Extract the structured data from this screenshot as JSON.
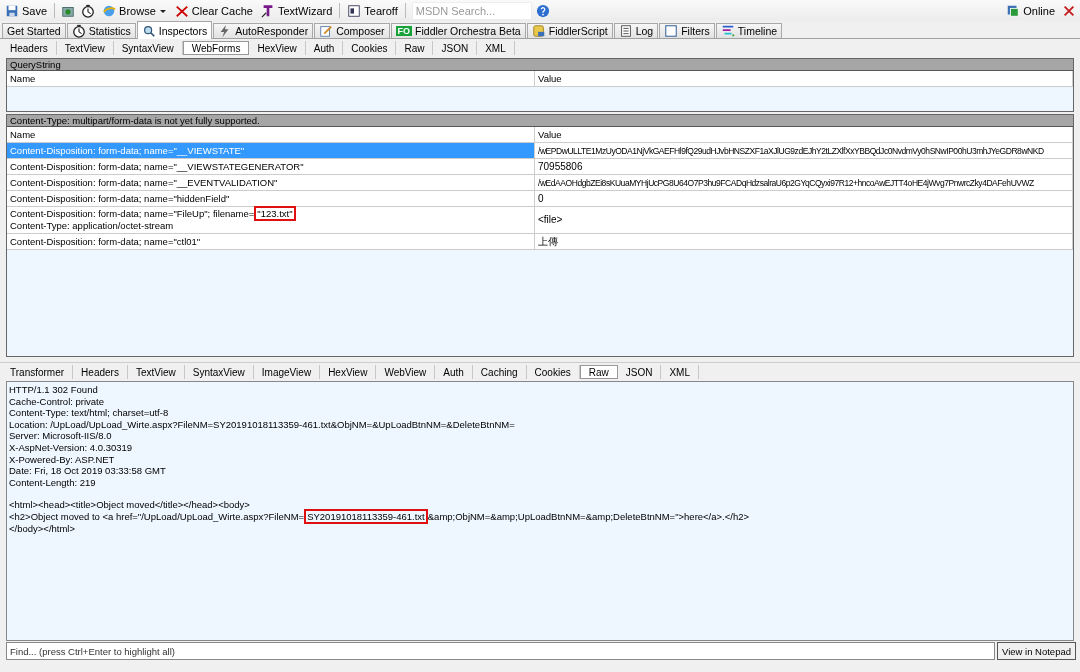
{
  "toolbar": {
    "items": [
      {
        "kind": "button",
        "label": "Save"
      },
      {
        "kind": "icon"
      },
      {
        "kind": "icon"
      },
      {
        "kind": "dropdown",
        "label": "Browse"
      },
      {
        "kind": "button",
        "label": "Clear Cache"
      },
      {
        "kind": "button",
        "label": "TextWizard"
      },
      {
        "kind": "button",
        "label": "Tearoff"
      }
    ],
    "search": {
      "placeholder": "MSDN Search..."
    },
    "online": {
      "label": "Online"
    }
  },
  "tabs": [
    {
      "label": "Get Started",
      "selected": false
    },
    {
      "label": "Statistics",
      "selected": false
    },
    {
      "label": "Inspectors",
      "selected": true
    },
    {
      "label": "AutoResponder",
      "selected": false
    },
    {
      "label": "Composer",
      "selected": false
    },
    {
      "label": "Fiddler Orchestra Beta",
      "badge": "FO",
      "selected": false
    },
    {
      "label": "FiddlerScript",
      "selected": false
    },
    {
      "label": "Log",
      "selected": false
    },
    {
      "label": "Filters",
      "selected": false
    },
    {
      "label": "Timeline",
      "selected": false
    }
  ],
  "request_tabs": [
    {
      "label": "Headers",
      "selected": false
    },
    {
      "label": "TextView",
      "selected": false
    },
    {
      "label": "SyntaxView",
      "selected": false
    },
    {
      "label": "WebForms",
      "selected": true
    },
    {
      "label": "HexView",
      "selected": false
    },
    {
      "label": "Auth",
      "selected": false
    },
    {
      "label": "Cookies",
      "selected": false
    },
    {
      "label": "Raw",
      "selected": false
    },
    {
      "label": "JSON",
      "selected": false
    },
    {
      "label": "XML",
      "selected": false
    }
  ],
  "query_string": {
    "title": "QueryString",
    "columns": [
      "Name",
      "Value"
    ]
  },
  "body": {
    "title": "Content-Type: multipart/form-data is not yet fully supported.",
    "columns": [
      "Name",
      "Value"
    ],
    "rows": [
      {
        "name": "Content-Disposition: form-data; name=\"__VIEWSTATE\"",
        "value": "/wEPDwULLTE1MzUyODA1NjVkGAEFHl9fQ29udHJvbHNSZXF1aXJlUG9zdEJhY2tLZXlfXxYBBQdJc0NvdmVy0hSNwIP00hU3mhJYeGDR8wNKD",
        "selected": true
      },
      {
        "name": "Content-Disposition: form-data; name=\"__VIEWSTATEGENERATOR\"",
        "value": "70955806",
        "selected": false
      },
      {
        "name": "Content-Disposition: form-data; name=\"__EVENTVALIDATION\"",
        "value": "/wEdAAOHdgbZEi8sKUuaMYHjUcPG8U64O7P3hu9FCADqHdzsalraU6p2GYqCQyxi97R12+hncoAwEJTT4oHE4jWvg7PnwrcZky4DAFehUVWZ",
        "selected": false
      },
      {
        "name": "Content-Disposition: form-data; name=\"hiddenField\"",
        "value": "0",
        "selected": false
      },
      {
        "name": "Content-Disposition: form-data; name=\"FileUp\"; filename=",
        "name_highlight": "\"123.txt\"",
        "name_line_2": "Content-Type: application/octet-stream",
        "value": "<file>",
        "selected": false
      },
      {
        "name": "Content-Disposition: form-data; name=\"ctl01\"",
        "value": "上傳",
        "selected": false
      }
    ]
  },
  "response_tabs": [
    {
      "label": "Transformer",
      "selected": false
    },
    {
      "label": "Headers",
      "selected": false
    },
    {
      "label": "TextView",
      "selected": false
    },
    {
      "label": "SyntaxView",
      "selected": false
    },
    {
      "label": "ImageView",
      "selected": false
    },
    {
      "label": "HexView",
      "selected": false
    },
    {
      "label": "WebView",
      "selected": false
    },
    {
      "label": "Auth",
      "selected": false
    },
    {
      "label": "Caching",
      "selected": false
    },
    {
      "label": "Cookies",
      "selected": false
    },
    {
      "label": "Raw",
      "selected": true
    },
    {
      "label": "JSON",
      "selected": false
    },
    {
      "label": "XML",
      "selected": false
    }
  ],
  "raw_response": {
    "headers": [
      "HTTP/1.1 302 Found",
      "Cache-Control: private",
      "Content-Type: text/html; charset=utf-8",
      "Location: /UpLoad/UpLoad_Wirte.aspx?FileNM=SY20191018113359-461.txt&ObjNM=&UpLoadBtnNM=&DeleteBtnNM=",
      "Server: Microsoft-IIS/8.0",
      "X-AspNet-Version: 4.0.30319",
      "X-Powered-By: ASP.NET",
      "Date: Fri, 18 Oct 2019 03:33:58 GMT",
      "Content-Length: 219"
    ],
    "body": [
      {
        "text": "<html><head><title>Object moved</title></head><body>"
      },
      {
        "text": "<h2>Object moved to <a href=\"/UpLoad/UpLoad_Wirte.aspx?FileNM=",
        "highlight": "SY20191018113359-461.txt",
        "after": "&amp;ObjNM=&amp;UpLoadBtnNM=&amp;DeleteBtnNM=\">here</a>.</h2>"
      },
      {
        "text": "</body></html>"
      }
    ]
  },
  "find_bar": {
    "placeholder": "Find... (press Ctrl+Enter to highlight all)",
    "button": "View in Notepad"
  }
}
